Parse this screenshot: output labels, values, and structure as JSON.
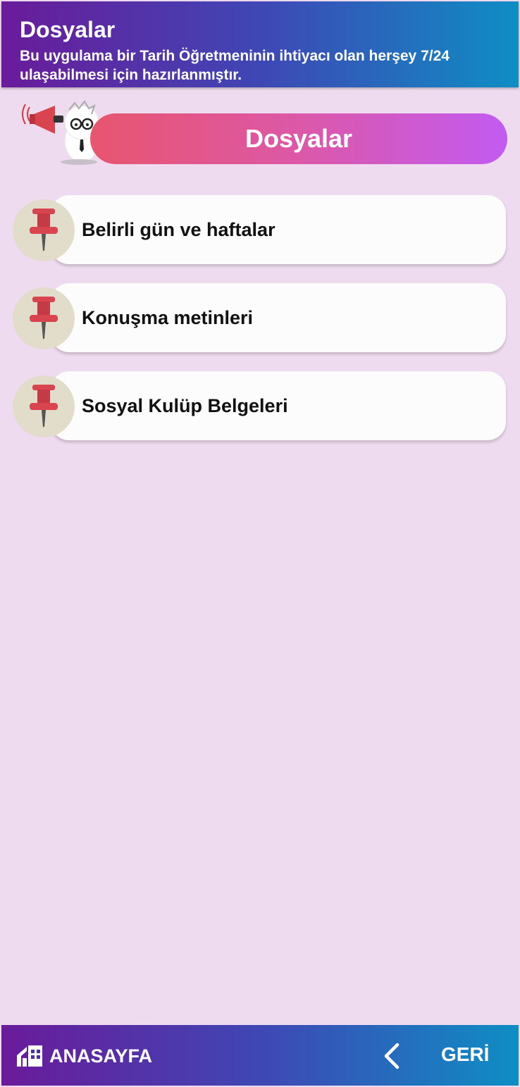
{
  "header": {
    "title": "Dosyalar",
    "subtitle": "Bu uygulama bir Tarih Öğretmeninin ihtiyacı olan herşey 7/24 ulaşabilmesi için hazırlanmıştır."
  },
  "section": {
    "title": "Dosyalar"
  },
  "items": [
    {
      "label": "Belirli gün ve haftalar",
      "icon": "pushpin-icon"
    },
    {
      "label": "Konuşma metinleri",
      "icon": "pushpin-icon"
    },
    {
      "label": "Sosyal Kulüp Belgeleri",
      "icon": "pushpin-icon"
    }
  ],
  "bottom_nav": {
    "home_label": "ANASAYFA",
    "home_icon": "home-icon",
    "back_label": "GERİ",
    "back_icon": "chevron-left-icon"
  },
  "colors": {
    "background": "#efdbef",
    "header_gradient": [
      "#6a1b9a",
      "#3f47b5",
      "#0e8ec4"
    ],
    "banner_gradient": [
      "#e8556e",
      "#dc58a8",
      "#c25bf2"
    ],
    "pin_red": "#d8454f"
  }
}
